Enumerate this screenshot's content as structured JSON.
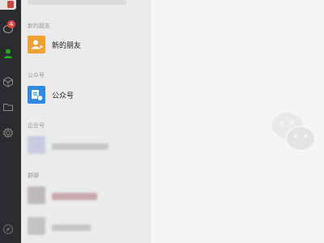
{
  "nav": {
    "badge_count": "4",
    "icons": [
      "chat-icon",
      "contacts-icon",
      "box-icon",
      "folder-icon",
      "settings-icon",
      "compass-icon"
    ]
  },
  "contacts": {
    "sections": {
      "new_friends": "新的朋友",
      "official_accounts": "公众号",
      "enterprise": "企业号",
      "groups": "群聊"
    },
    "rows": {
      "new_friends_label": "新的朋友",
      "official_accounts_label": "公众号"
    }
  },
  "colors": {
    "accent_green": "#1aad19",
    "new_friend_orange": "#f0a030",
    "official_blue": "#2d8ae0",
    "badge_red": "#e64340"
  }
}
